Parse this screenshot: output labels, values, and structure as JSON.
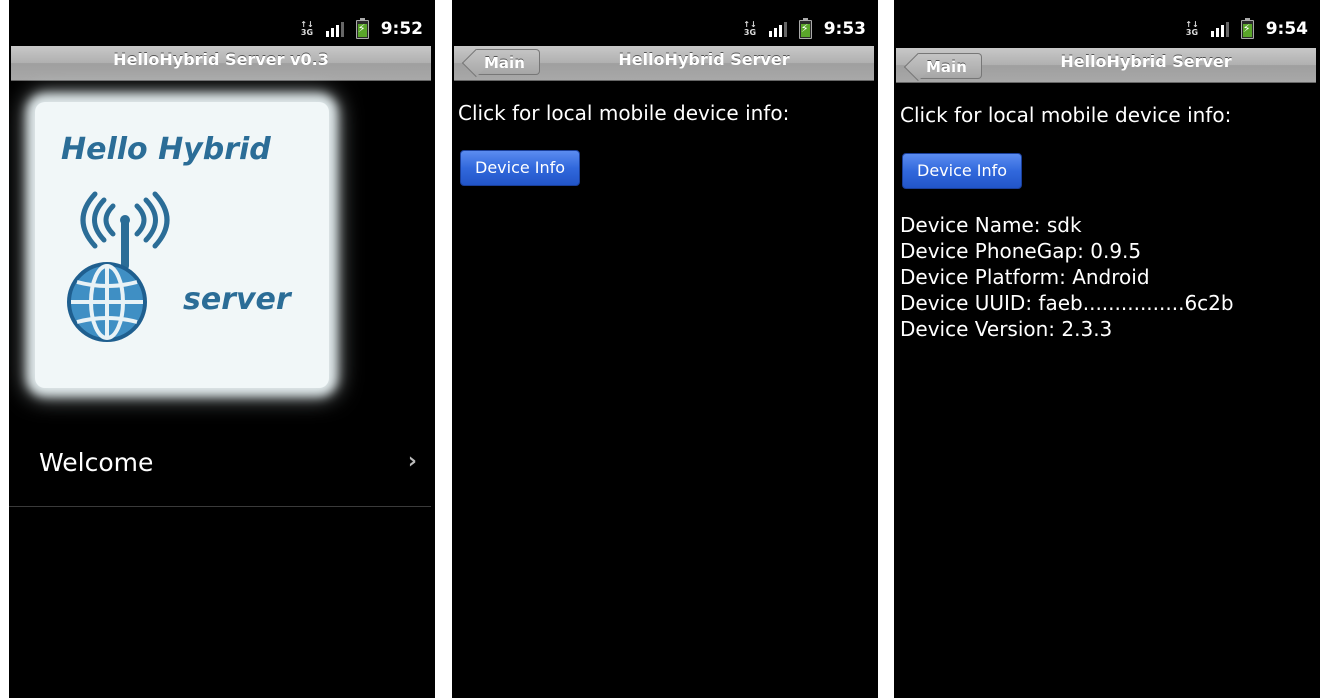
{
  "screens": [
    {
      "status": {
        "network": "3G",
        "time": "9:52"
      },
      "title": "HelloHybrid Server v0.3",
      "logo": {
        "line1": "Hello Hybrid",
        "line2": "server"
      },
      "list": [
        {
          "label": "Welcome",
          "chevron": "›"
        }
      ]
    },
    {
      "status": {
        "network": "3G",
        "time": "9:53"
      },
      "title": "HelloHybrid Server",
      "back_label": "Main",
      "prompt": "Click for local mobile device info:",
      "button_label": "Device Info"
    },
    {
      "status": {
        "network": "3G",
        "time": "9:54"
      },
      "title": "HelloHybrid Server",
      "back_label": "Main",
      "prompt": "Click for local mobile device info:",
      "button_label": "Device Info",
      "device_info": [
        "Device Name: sdk",
        "Device PhoneGap: 0.9.5",
        "Device Platform: Android",
        "Device UUID: faeb................6c2b",
        "Device Version: 2.3.3"
      ]
    }
  ],
  "colors": {
    "screen_bg": "#000000",
    "titlebar": "#b0b0b0",
    "button_blue": "#3168dc",
    "logo_blue": "#2b6d97"
  },
  "icons": [
    "network-3g-icon",
    "signal-icon",
    "battery-charging-icon",
    "back-arrow-icon",
    "chevron-right-icon",
    "antenna-globe-icon"
  ]
}
